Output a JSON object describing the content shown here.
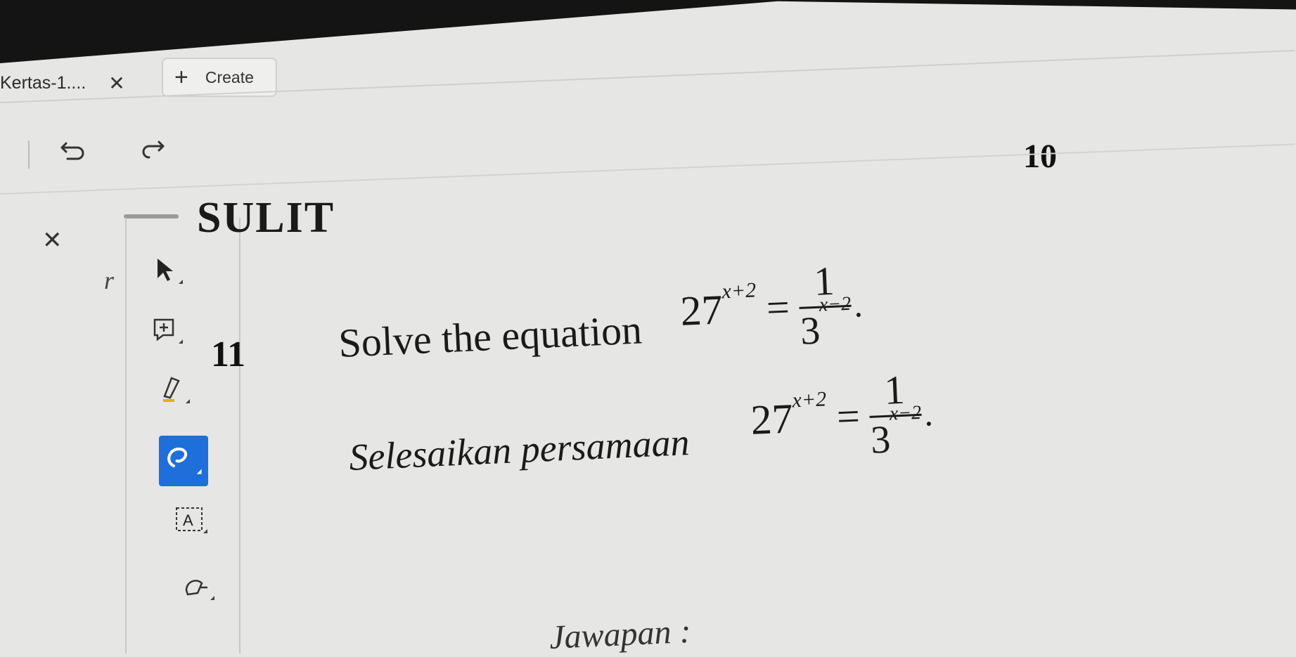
{
  "tabs": [
    {
      "label": "Kertas-1...."
    }
  ],
  "create_button": {
    "label": "Create"
  },
  "page_number": "10",
  "side_panel_letter": "r",
  "document": {
    "header": "SULIT",
    "question_number": "11",
    "prompt_en": "Solve the equation",
    "prompt_ms": "Selesaikan persamaan",
    "equation": {
      "lhs_base": "27",
      "lhs_exponent": "x+2",
      "equals": "=",
      "numerator": "1",
      "den_base": "3",
      "den_exponent": "x−2",
      "trailing": "."
    },
    "answer_label": "Jawapan :"
  },
  "tools": [
    {
      "name": "select-tool",
      "icon": "cursor-arrow-icon"
    },
    {
      "name": "insert-comment-tool",
      "icon": "comment-plus-icon"
    },
    {
      "name": "highlighter-tool",
      "icon": "highlighter-icon"
    },
    {
      "name": "freehand-draw-tool",
      "icon": "freehand-icon",
      "active": true
    },
    {
      "name": "text-box-tool",
      "icon": "text-box-icon"
    },
    {
      "name": "stamp-tool",
      "icon": "stamp-icon"
    }
  ],
  "colors": {
    "accent": "#1e6fd9",
    "background": "#e6e6e4"
  }
}
